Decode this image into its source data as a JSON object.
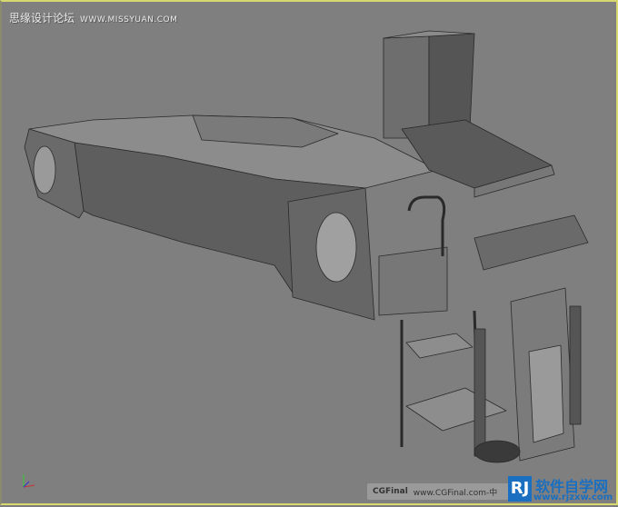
{
  "viewport": {
    "border_color": "#d8d870",
    "background": "#7f7f7f",
    "axis_labels": [
      "x",
      "y",
      "z"
    ]
  },
  "watermarks": {
    "top_left_cn": "思缘设计论坛",
    "top_left_site": "WWW.MISSYUAN.COM",
    "cgfinal_logo": "CGFinal",
    "cgfinal_text": "www.CGFinal.com-中",
    "rjzxw_logo": "RJ",
    "rjzxw_cn": "软件自学网",
    "rjzxw_url": "www.rjzxw.com"
  }
}
